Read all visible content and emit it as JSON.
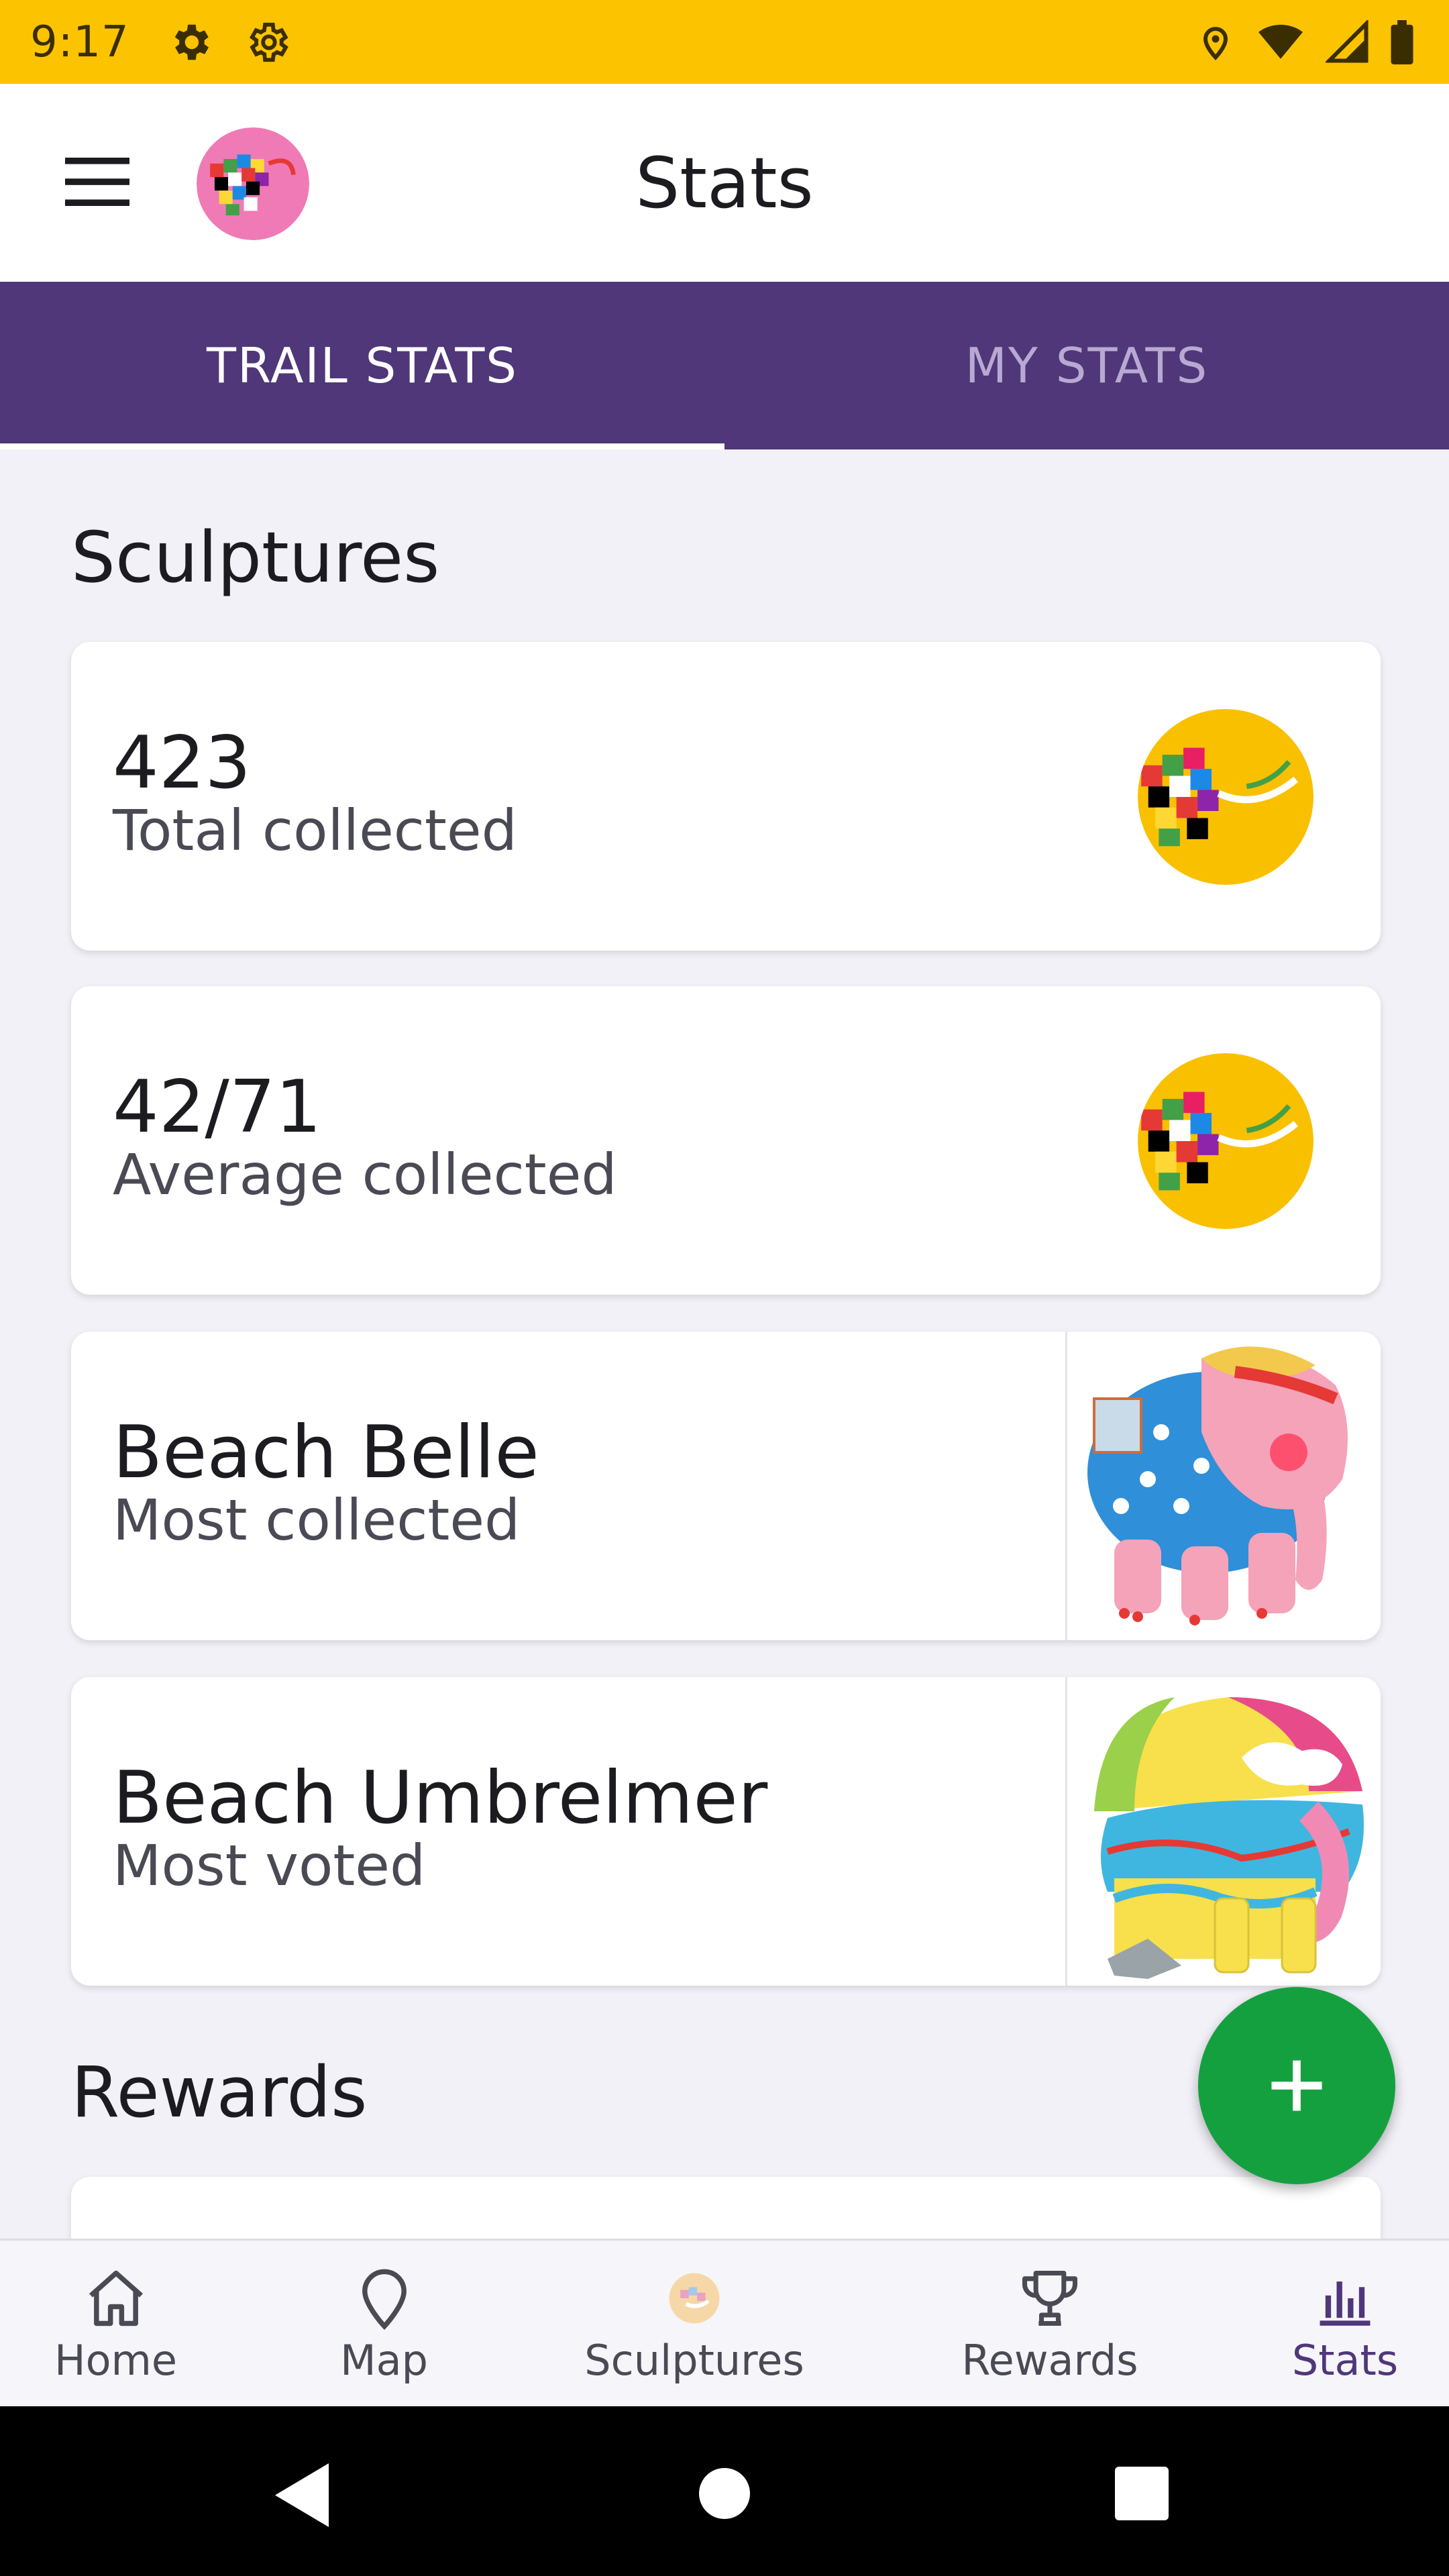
{
  "status_bar": {
    "time": "9:17",
    "icons": [
      "gear-icon",
      "gear-outline-icon",
      "location-icon",
      "wifi-icon",
      "signal-icon",
      "battery-icon"
    ]
  },
  "app_bar": {
    "title": "Stats",
    "menu_icon": "menu-icon",
    "logo": "elephant-logo"
  },
  "tabs": [
    {
      "label": "TRAIL STATS",
      "active": true
    },
    {
      "label": "MY STATS",
      "active": false
    }
  ],
  "sections": {
    "sculptures_title": "Sculptures",
    "rewards_title": "Rewards"
  },
  "cards": [
    {
      "value": "423",
      "label": "Total collected",
      "image": "elephant-badge-icon"
    },
    {
      "value": "42/71",
      "label": "Average collected",
      "image": "elephant-badge-icon"
    },
    {
      "value": "Beach Belle",
      "label": "Most collected",
      "image": "beach-belle-sculpture"
    },
    {
      "value": "Beach Umbrelmer",
      "label": "Most voted",
      "image": "beach-umbrelmer-sculpture"
    }
  ],
  "fab": {
    "icon": "plus-icon"
  },
  "bottom_nav": [
    {
      "label": "Home",
      "icon": "home-icon",
      "active": false
    },
    {
      "label": "Map",
      "icon": "map-pin-icon",
      "active": false
    },
    {
      "label": "Sculptures",
      "icon": "sculpture-icon",
      "active": false
    },
    {
      "label": "Rewards",
      "icon": "trophy-icon",
      "active": false
    },
    {
      "label": "Stats",
      "icon": "bar-chart-icon",
      "active": true
    }
  ],
  "colors": {
    "status_bar": "#fcc300",
    "tab_bar": "#4f3779",
    "fab": "#15a040",
    "background": "#f2f1f7"
  }
}
